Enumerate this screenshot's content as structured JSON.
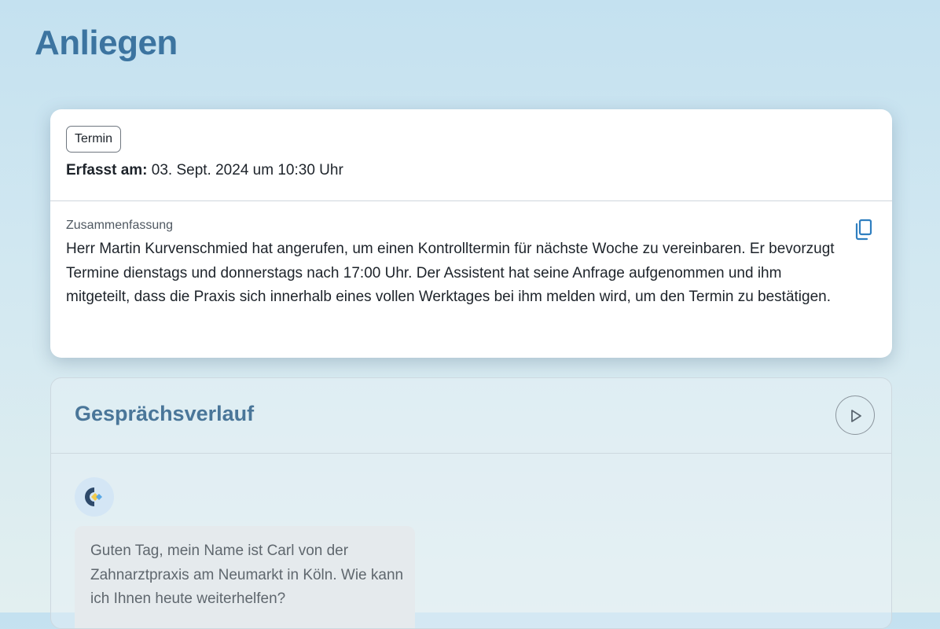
{
  "page": {
    "title": "Anliegen"
  },
  "request": {
    "tag": "Termin",
    "recorded_label": "Erfasst am:",
    "recorded_value": "03. Sept. 2024 um 10:30 Uhr",
    "summary_label": "Zusammenfassung",
    "summary_text": "Herr Martin Kurvenschmied hat angerufen, um einen Kontrolltermin für nächste Woche zu vereinbaren. Er bevorzugt Termine dienstags und donnerstags nach 17:00 Uhr. Der Assistent hat seine Anfrage aufgenommen und ihm mitgeteilt, dass die Praxis sich innerhalb eines vollen Werktages bei ihm melden wird, um den Termin zu bestätigen.",
    "copy_icon": "copy-icon"
  },
  "conversation": {
    "title": "Gesprächsverlauf",
    "play_icon": "play-icon",
    "messages": [
      {
        "speaker_icon": "assistant-logo-icon",
        "text": "Guten Tag, mein Name ist Carl von der Zahnarztpraxis am Neumarkt in Köln. Wie kann ich Ihnen heute weiterhelfen?"
      }
    ]
  },
  "colors": {
    "accent": "#3c74a0",
    "panel_title": "#4a7699",
    "copy_icon": "#2f7fc0",
    "logo_dark": "#2e4a6b",
    "logo_yellow": "#f2cb4c",
    "logo_blue": "#5aa8e6"
  }
}
